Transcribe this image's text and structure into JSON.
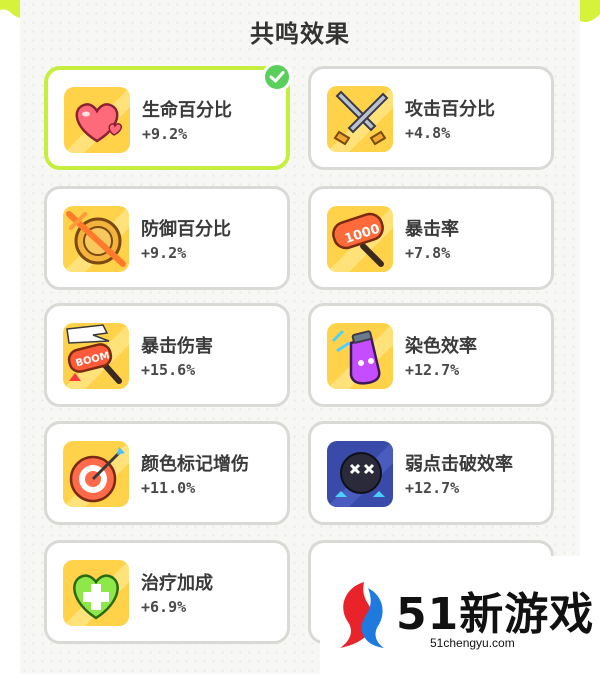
{
  "panel": {
    "title": "共鸣效果"
  },
  "effects": [
    {
      "name": "生命百分比",
      "value": "+9.2%",
      "icon": "heart-icon",
      "selected": true
    },
    {
      "name": "攻击百分比",
      "value": "+4.8%",
      "icon": "sword-icon"
    },
    {
      "name": "防御百分比",
      "value": "+9.2%",
      "icon": "shield-broken-icon"
    },
    {
      "name": "暴击率",
      "value": "+7.8%",
      "icon": "hammer-1000-icon"
    },
    {
      "name": "暴击伤害",
      "value": "+15.6%",
      "icon": "boom-hammer-icon"
    },
    {
      "name": "染色效率",
      "value": "+12.7%",
      "icon": "paint-potion-icon"
    },
    {
      "name": "颜色标记增伤",
      "value": "+11.0%",
      "icon": "target-icon"
    },
    {
      "name": "弱点击破效率",
      "value": "+12.7%",
      "icon": "weak-point-icon"
    },
    {
      "name": "治疗加成",
      "value": "+6.9%",
      "icon": "heal-heart-icon"
    }
  ],
  "watermark": {
    "text": "51新游戏",
    "url": "51chengyu.com"
  },
  "colors": {
    "accent": "#c7ee3e",
    "check": "#5ad05c",
    "border": "#d9dad6"
  }
}
